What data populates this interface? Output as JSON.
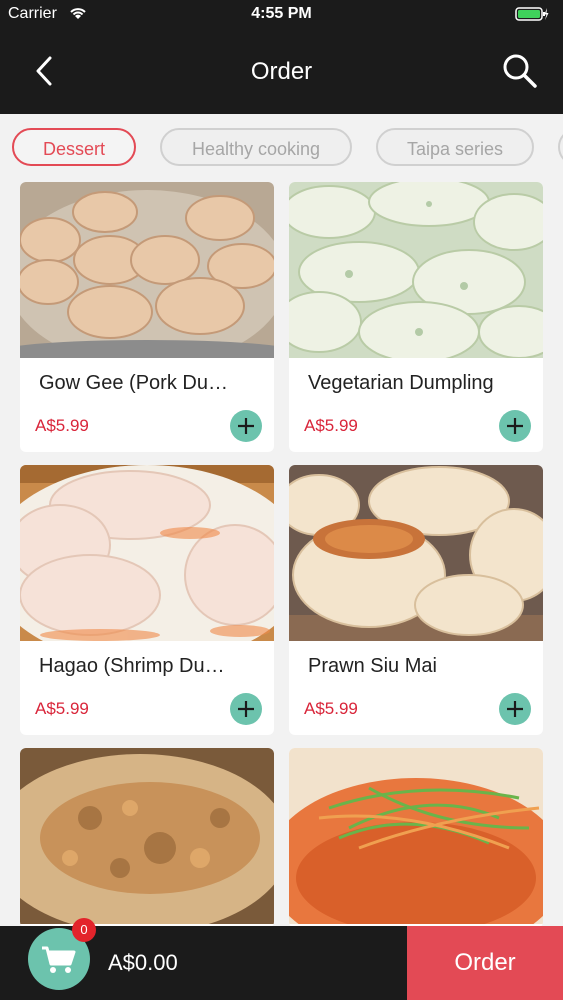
{
  "status": {
    "carrier": "Carrier",
    "time": "4:55 PM"
  },
  "nav": {
    "title": "Order",
    "back_icon": "chevron-left-icon",
    "search_icon": "search-icon"
  },
  "tabs": [
    {
      "label": "Dessert",
      "active": true
    },
    {
      "label": "Healthy cooking",
      "active": false
    },
    {
      "label": "Taipa series",
      "active": false
    }
  ],
  "items": [
    {
      "name": "Gow Gee (Pork Du…",
      "price": "A$5.99"
    },
    {
      "name": "Vegetarian Dumpling",
      "price": "A$5.99"
    },
    {
      "name": "Hagao (Shrimp Du…",
      "price": "A$5.99"
    },
    {
      "name": "Prawn Siu Mai",
      "price": "A$5.99"
    },
    {
      "name": "",
      "price": ""
    },
    {
      "name": "",
      "price": ""
    }
  ],
  "cart": {
    "count": "0",
    "total": "A$0.00",
    "order_label": "Order"
  },
  "colors": {
    "accent": "#e34a55",
    "add_button": "#6cc3ad",
    "price": "#d9253a",
    "bar": "#1b1b1b"
  }
}
